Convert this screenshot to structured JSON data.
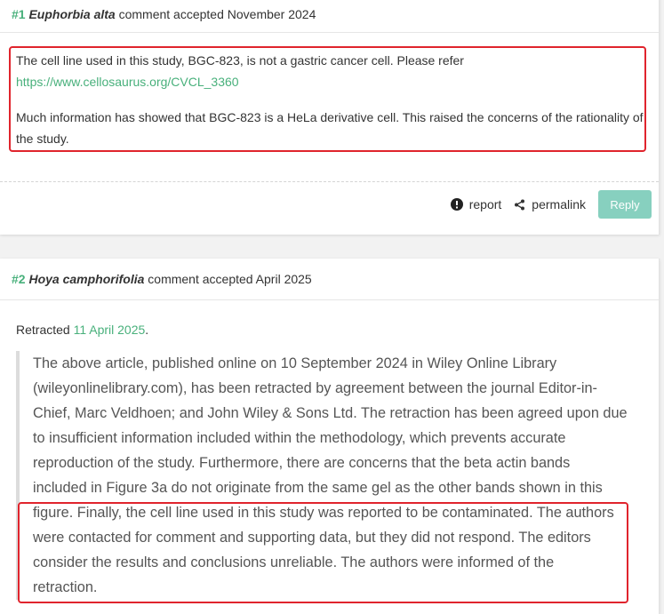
{
  "comment1": {
    "number": "#1",
    "author": "Euphorbia alta",
    "status": "comment accepted November 2024",
    "line1": "The cell line used in this study, BGC-823, is not a gastric cancer cell. Please refer",
    "link": "https://www.cellosaurus.org/CVCL_3360",
    "line2": "Much information has showed that BGC-823 is a HeLa derivative cell. This raised the concerns of the rationality of",
    "line3": "the study.",
    "actions": {
      "report": "report",
      "permalink": "permalink",
      "reply": "Reply"
    }
  },
  "comment2": {
    "number": "#2",
    "author": "Hoya camphorifolia",
    "status": "comment accepted April 2025",
    "retracted_prefix": "Retracted",
    "retracted_date": "11 April 2025",
    "retracted_suffix": ".",
    "quote_lines": [
      "The above article, published online on 10 September 2024 in Wiley Online Library",
      "(wileyonlinelibrary.com), has been retracted by agreement between the journal Editor-in-",
      "Chief, Marc Veldhoen; and John Wiley & Sons Ltd. The retraction has been agreed upon due",
      "to insufficient information included within the methodology, which prevents accurate",
      "reproduction of the study. Furthermore, there are concerns that the beta actin bands",
      "included in Figure 3a do not originate from the same gel as the other bands shown in this",
      "figure. Finally, the cell line used in this study was reported to be contaminated. The authors",
      "were contacted for comment and supporting data, but they did not respond. The editors",
      "consider the results and conclusions unreliable. The authors were informed of the",
      "retraction."
    ]
  },
  "colors": {
    "accent": "#48b07b",
    "highlight": "#e0242d",
    "reply_button": "#87d0bf"
  },
  "icons": {
    "report": "exclamation-circle-icon",
    "permalink": "share-icon"
  }
}
